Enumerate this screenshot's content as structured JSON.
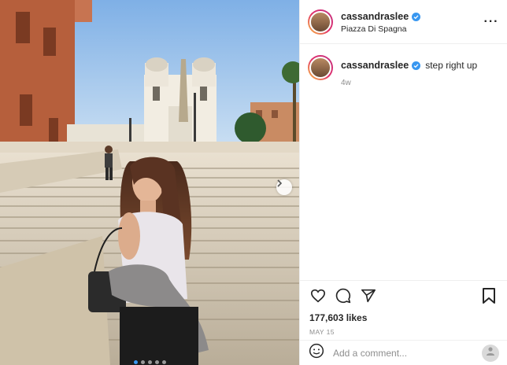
{
  "post": {
    "username": "cassandraslee",
    "location": "Piazza Di Spagna",
    "caption": "step right up",
    "age": "4w",
    "likes": "177,603 likes",
    "date": "MAY 15",
    "comment_placeholder": "Add a comment...",
    "verified": true
  },
  "carousel": {
    "total": 5,
    "active_index": 0
  },
  "colors": {
    "accent": "#3897f0",
    "text": "#262626",
    "muted": "#8e8e8e",
    "border": "#efefef"
  },
  "icons": {
    "more": "more-horizontal-icon",
    "like": "heart-icon",
    "comment": "comment-icon",
    "share": "paper-plane-icon",
    "save": "bookmark-icon",
    "emoji": "emoji-icon",
    "next": "chevron-right-icon"
  }
}
